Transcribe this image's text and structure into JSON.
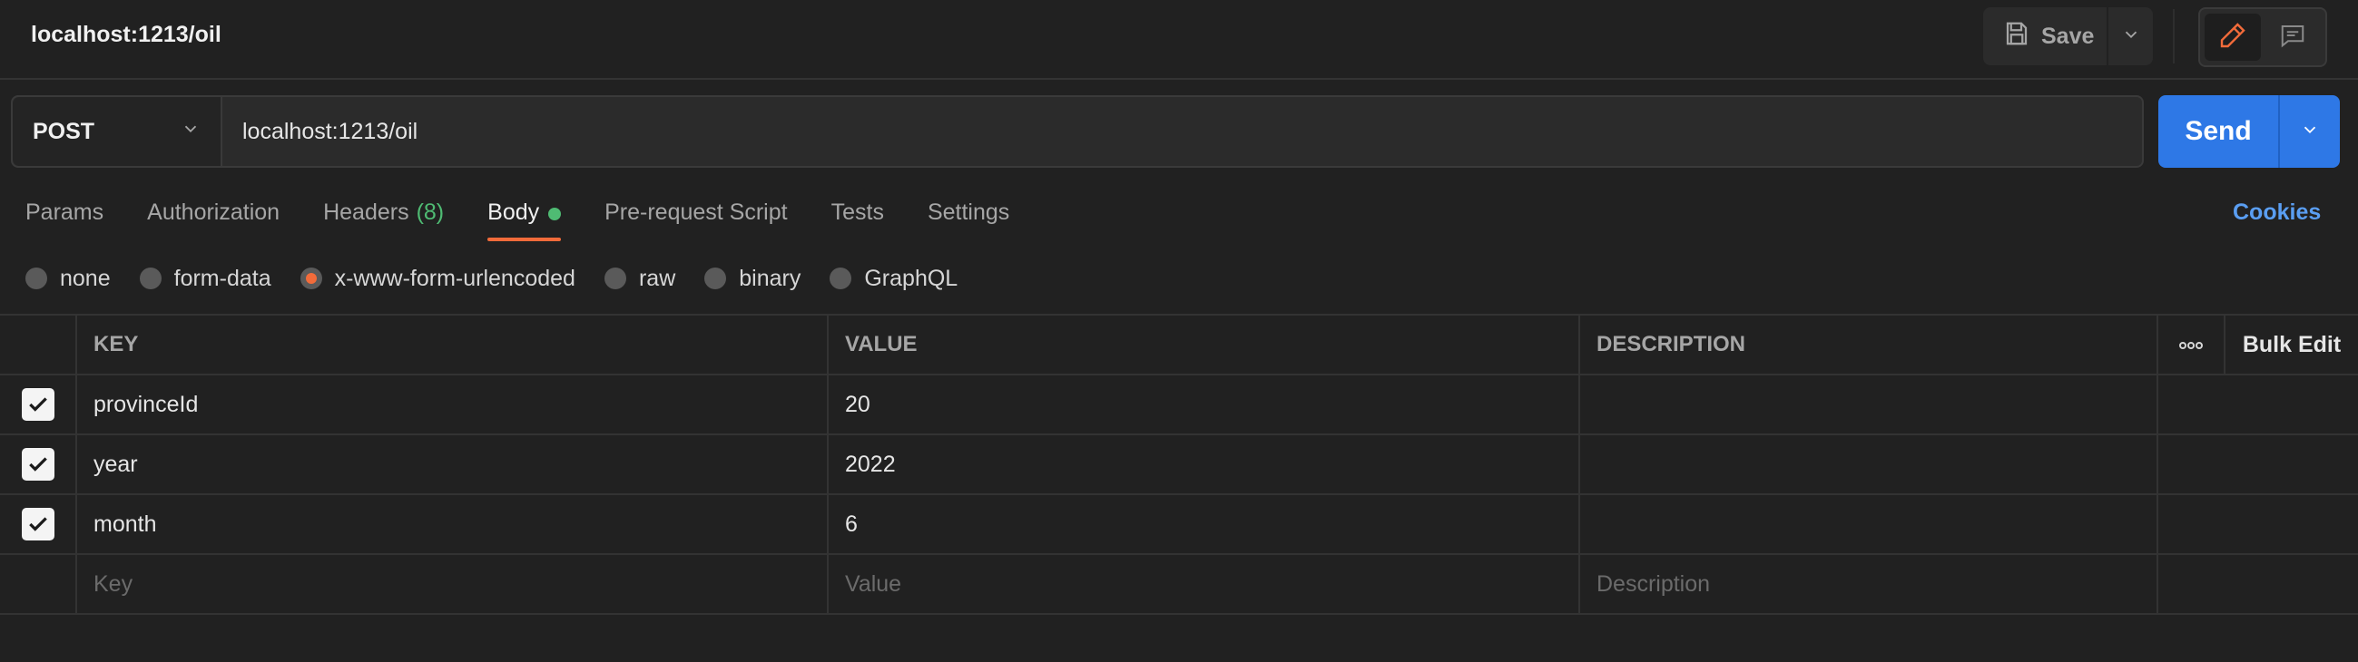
{
  "header": {
    "title": "localhost:1213/oil",
    "save_label": "Save"
  },
  "request": {
    "method": "POST",
    "url": "localhost:1213/oil",
    "send_label": "Send"
  },
  "tabs": [
    {
      "label": "Params"
    },
    {
      "label": "Authorization"
    },
    {
      "label": "Headers",
      "count": "(8)"
    },
    {
      "label": "Body",
      "active": true
    },
    {
      "label": "Pre-request Script"
    },
    {
      "label": "Tests"
    },
    {
      "label": "Settings"
    }
  ],
  "cookies_label": "Cookies",
  "body_types": [
    {
      "label": "none"
    },
    {
      "label": "form-data"
    },
    {
      "label": "x-www-form-urlencoded",
      "selected": true
    },
    {
      "label": "raw"
    },
    {
      "label": "binary"
    },
    {
      "label": "GraphQL"
    }
  ],
  "table": {
    "columns": {
      "key": "KEY",
      "value": "VALUE",
      "description": "DESCRIPTION",
      "bulk_edit": "Bulk Edit"
    },
    "rows": [
      {
        "key": "provinceId",
        "value": "20",
        "description": "",
        "checked": true
      },
      {
        "key": "year",
        "value": "2022",
        "description": "",
        "checked": true
      },
      {
        "key": "month",
        "value": "6",
        "description": "",
        "checked": true
      }
    ],
    "placeholders": {
      "key": "Key",
      "value": "Value",
      "description": "Description"
    }
  },
  "colors": {
    "accent": "#f26b3a",
    "send_blue": "#2e78e6",
    "link_blue": "#5a9ef2",
    "green": "#4fbb73"
  }
}
